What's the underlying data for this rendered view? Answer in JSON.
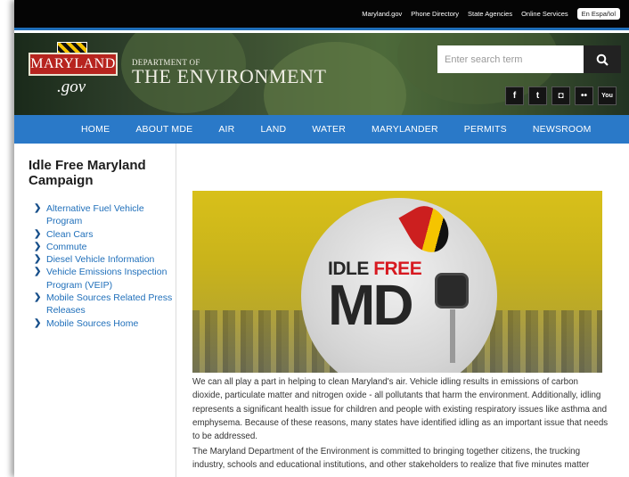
{
  "utility_links": [
    "Maryland.gov",
    "Phone Directory",
    "State Agencies",
    "Online Services"
  ],
  "espanol_label": "En Español",
  "logo": {
    "state": "MARYLAND",
    "gov": ".gov"
  },
  "department": {
    "small": "DEPARTMENT OF",
    "big": "THE ENVIRONMENT"
  },
  "search": {
    "placeholder": "Enter search term",
    "icon": "search-icon"
  },
  "social": [
    {
      "name": "facebook-icon",
      "glyph": "f"
    },
    {
      "name": "twitter-icon",
      "glyph": "t"
    },
    {
      "name": "instagram-icon",
      "glyph": "◘"
    },
    {
      "name": "flickr-icon",
      "glyph": "••"
    },
    {
      "name": "youtube-icon",
      "glyph": "You"
    }
  ],
  "nav": [
    "HOME",
    "ABOUT MDE",
    "AIR",
    "LAND",
    "WATER",
    "MARYLANDER",
    "PERMITS",
    "NEWSROOM"
  ],
  "sidebar": {
    "title": "Idle Free Maryland Campaign",
    "items": [
      "Alternative Fuel Vehicle Program",
      "Clean Cars",
      "Commute",
      "Diesel Vehicle Information",
      "Vehicle Emissions Inspection Program (VEIP)",
      "Mobile Sources Related Press Releases",
      "Mobile Sources Home"
    ]
  },
  "hero": {
    "idle": "IDLE",
    "free": "FREE",
    "md": "MD"
  },
  "content": {
    "p1": "We can all play a part in helping to clean Maryland's air. Vehicle idling results in emissions of carbon dioxide, particulate matter and nitrogen oxide - all pollutants that harm the environment. Additionally, idling represents a significant health issue for children and people with existing respiratory issues like asthma and emphysema. Because of these reasons, many states have identified idling as an important issue that needs to be addressed.",
    "p2": "The Maryland Department of the Environment is committed to bringing together citizens, the trucking industry, schools and educational institutions, and other stakeholders to realize that five minutes matter"
  },
  "colors": {
    "nav_bg": "#2a79c8",
    "link": "#1f6fba",
    "utility_bg": "#050505"
  }
}
